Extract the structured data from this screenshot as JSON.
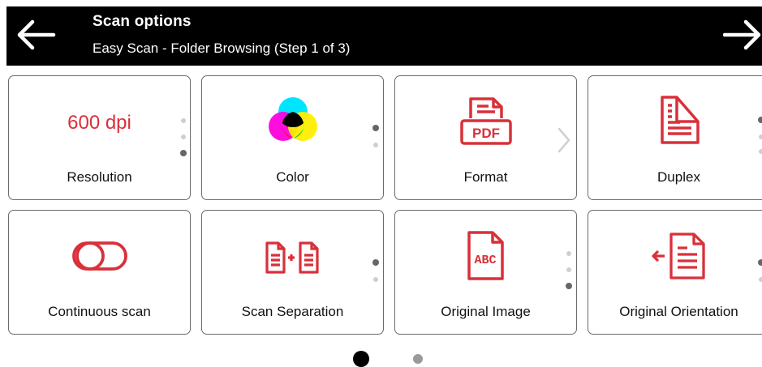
{
  "header": {
    "title": "Scan options",
    "subtitle": "Easy Scan - Folder Browsing (Step 1 of 3)"
  },
  "accent_color": "#d9303a",
  "tiles": [
    {
      "label": "Resolution",
      "value": "600 dpi",
      "icon": "resolution-value"
    },
    {
      "label": "Color",
      "icon": "color-circles-icon"
    },
    {
      "label": "Format",
      "icon": "pdf-file-icon"
    },
    {
      "label": "Duplex",
      "icon": "duplex-pages-icon"
    },
    {
      "label": "Continuous scan",
      "icon": "toggle-icon"
    },
    {
      "label": "Scan Separation",
      "icon": "scan-separation-icon"
    },
    {
      "label": "Original Image",
      "icon": "abc-document-icon"
    },
    {
      "label": "Original Orientation",
      "icon": "orientation-icon"
    }
  ],
  "pager": {
    "pages": 2,
    "current": 1
  }
}
